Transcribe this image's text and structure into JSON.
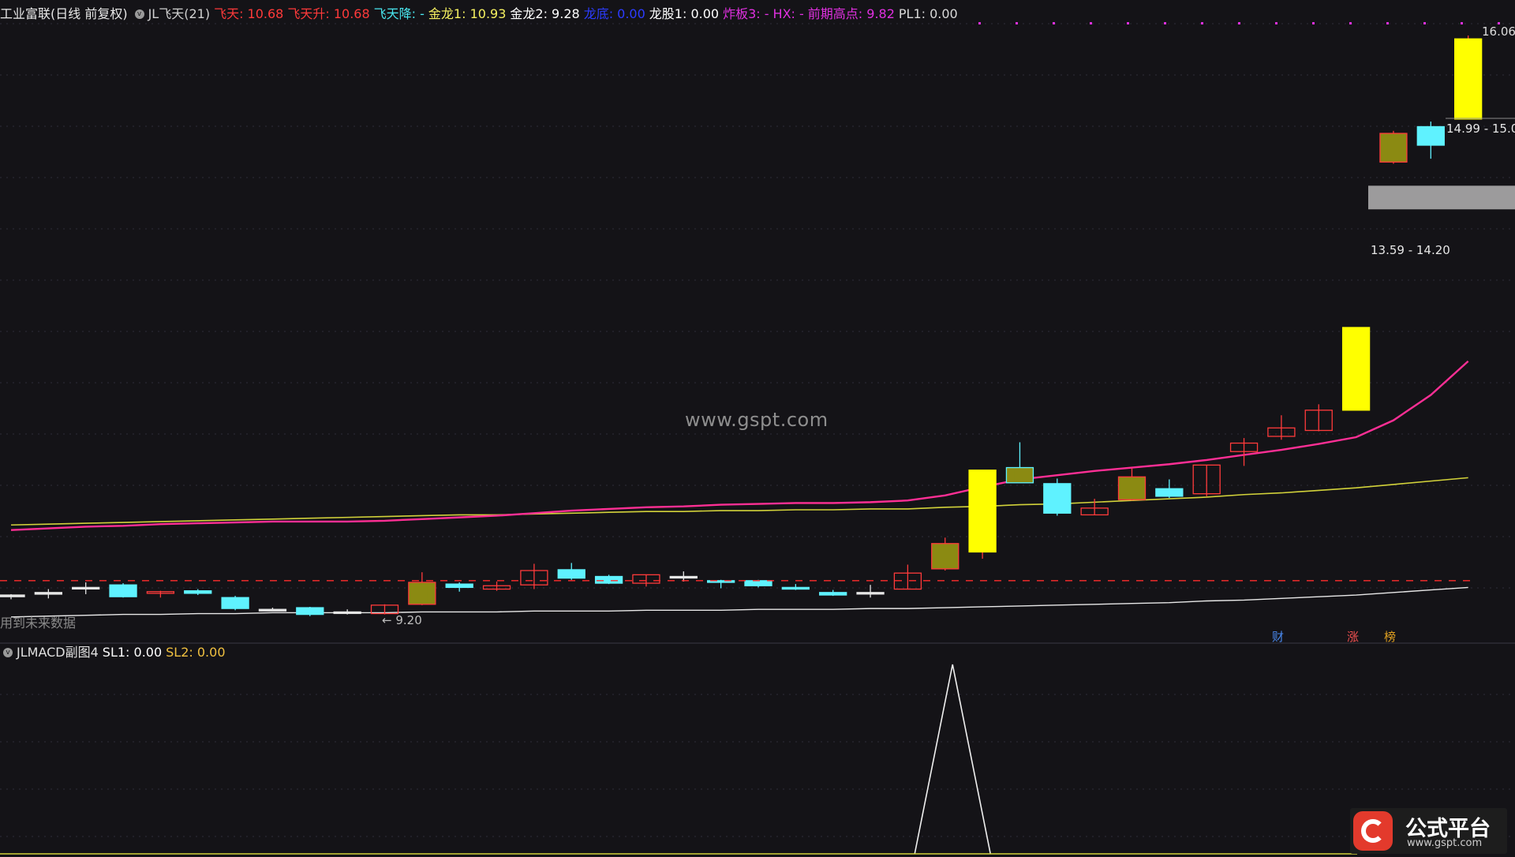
{
  "main_legend": {
    "stock_title": "工业富联(日线 前复权)",
    "indicator_name": "JL飞天(21)",
    "items": [
      {
        "text": "飞天: 10.68",
        "color": "#ff3a3a"
      },
      {
        "text": "飞天升: 10.68",
        "color": "#ff3a3a"
      },
      {
        "text": "飞天降: -",
        "color": "#49e6ef"
      },
      {
        "text": "金龙1: 10.93",
        "color": "#f5f060"
      },
      {
        "text": "金龙2: 9.28",
        "color": "#ffffff"
      },
      {
        "text": "龙底: 0.00",
        "color": "#2c3cff"
      },
      {
        "text": "龙股1: 0.00",
        "color": "#ffffff"
      },
      {
        "text": "炸板3: -",
        "color": "#e030e0"
      },
      {
        "text": "HX: -",
        "color": "#e030e0"
      },
      {
        "text": "前期高点: 9.82",
        "color": "#e030e0"
      },
      {
        "text": "PL1: 0.00",
        "color": "#d8d8d8"
      }
    ]
  },
  "sub_legend": {
    "indicator_name": "JLMACD副图4",
    "items": [
      {
        "text": "SL1: 0.00",
        "color": "#ffffff"
      },
      {
        "text": "SL2: 0.00",
        "color": "#f0c040"
      }
    ]
  },
  "price_labels": {
    "high": "16.06",
    "zone_upper": "14.99 - 15.0",
    "zone_lower": "13.59 - 14.20",
    "low_arrow": "← 9.20"
  },
  "future_data_note": "用到未来数据",
  "badges": [
    {
      "text": "财",
      "color": "#4a8af0"
    },
    {
      "text": "涨",
      "color": "#f05050"
    },
    {
      "text": "榜",
      "color": "#e0a020"
    }
  ],
  "watermark": "www.gspt.com",
  "logo": {
    "main": "公式平台",
    "url": "www.gspt.com"
  },
  "colors": {
    "up_candle": "#ff3b3b",
    "down_candle": "#5ff2ff",
    "limit_up": "#ffff00",
    "ma_pink": "#ff2f95",
    "ma_yellow": "#d2d23a",
    "ma_white": "#e8e8e8",
    "dashed_ref": "#ff2c2c",
    "zone_gray": "#b4b4b4"
  },
  "chart_data": {
    "type": "candlestick",
    "y_range": [
      9.0,
      16.2
    ],
    "candles": [
      {
        "o": 9.41,
        "c": 9.43,
        "h": 9.44,
        "l": 9.38,
        "t": "flat"
      },
      {
        "o": 9.46,
        "c": 9.44,
        "h": 9.5,
        "l": 9.39,
        "t": "flat"
      },
      {
        "o": 9.52,
        "c": 9.51,
        "h": 9.58,
        "l": 9.44,
        "t": "flat"
      },
      {
        "o": 9.55,
        "c": 9.41,
        "h": 9.57,
        "l": 9.4,
        "t": "down"
      },
      {
        "o": 9.45,
        "c": 9.47,
        "h": 9.48,
        "l": 9.4,
        "t": "up"
      },
      {
        "o": 9.48,
        "c": 9.45,
        "h": 9.5,
        "l": 9.43,
        "t": "down"
      },
      {
        "o": 9.4,
        "c": 9.27,
        "h": 9.42,
        "l": 9.25,
        "t": "down"
      },
      {
        "o": 9.26,
        "c": 9.25,
        "h": 9.28,
        "l": 9.24,
        "t": "flat"
      },
      {
        "o": 9.28,
        "c": 9.2,
        "h": 9.29,
        "l": 9.18,
        "t": "down"
      },
      {
        "o": 9.23,
        "c": 9.22,
        "h": 9.26,
        "l": 9.2,
        "t": "flat"
      },
      {
        "o": 9.21,
        "c": 9.31,
        "h": 9.32,
        "l": 9.2,
        "t": "up"
      },
      {
        "o": 9.32,
        "c": 9.58,
        "h": 9.7,
        "l": 9.31,
        "t": "up_fill"
      },
      {
        "o": 9.56,
        "c": 9.52,
        "h": 9.58,
        "l": 9.47,
        "t": "down"
      },
      {
        "o": 9.5,
        "c": 9.54,
        "h": 9.59,
        "l": 9.48,
        "t": "up"
      },
      {
        "o": 9.55,
        "c": 9.72,
        "h": 9.8,
        "l": 9.5,
        "t": "up"
      },
      {
        "o": 9.73,
        "c": 9.63,
        "h": 9.81,
        "l": 9.61,
        "t": "down"
      },
      {
        "o": 9.65,
        "c": 9.57,
        "h": 9.67,
        "l": 9.56,
        "t": "down"
      },
      {
        "o": 9.57,
        "c": 9.67,
        "h": 9.67,
        "l": 9.53,
        "t": "up"
      },
      {
        "o": 9.65,
        "c": 9.64,
        "h": 9.71,
        "l": 9.59,
        "t": "flat"
      },
      {
        "o": 9.6,
        "c": 9.58,
        "h": 9.61,
        "l": 9.51,
        "t": "down"
      },
      {
        "o": 9.6,
        "c": 9.54,
        "h": 9.61,
        "l": 9.52,
        "t": "down"
      },
      {
        "o": 9.52,
        "c": 9.5,
        "h": 9.56,
        "l": 9.49,
        "t": "down"
      },
      {
        "o": 9.46,
        "c": 9.43,
        "h": 9.49,
        "l": 9.42,
        "t": "down"
      },
      {
        "o": 9.45,
        "c": 9.46,
        "h": 9.55,
        "l": 9.4,
        "t": "flat"
      },
      {
        "o": 9.5,
        "c": 9.69,
        "h": 9.79,
        "l": 9.5,
        "t": "up"
      },
      {
        "o": 9.74,
        "c": 10.04,
        "h": 10.11,
        "l": 9.72,
        "t": "up_fill"
      },
      {
        "o": 9.94,
        "c": 10.91,
        "h": 10.91,
        "l": 9.86,
        "t": "limit"
      },
      {
        "o": 10.76,
        "c": 10.94,
        "h": 11.24,
        "l": 10.76,
        "t": "down_fill"
      },
      {
        "o": 10.75,
        "c": 10.4,
        "h": 10.81,
        "l": 10.37,
        "t": "down"
      },
      {
        "o": 10.38,
        "c": 10.46,
        "h": 10.57,
        "l": 10.38,
        "t": "up"
      },
      {
        "o": 10.56,
        "c": 10.83,
        "h": 10.93,
        "l": 10.55,
        "t": "up_fill"
      },
      {
        "o": 10.69,
        "c": 10.6,
        "h": 10.8,
        "l": 10.58,
        "t": "down"
      },
      {
        "o": 10.63,
        "c": 10.97,
        "h": 10.97,
        "l": 10.6,
        "t": "up"
      },
      {
        "o": 11.13,
        "c": 11.23,
        "h": 11.29,
        "l": 10.96,
        "t": "up"
      },
      {
        "o": 11.31,
        "c": 11.41,
        "h": 11.56,
        "l": 11.27,
        "t": "up"
      },
      {
        "o": 11.38,
        "c": 11.62,
        "h": 11.69,
        "l": 11.37,
        "t": "up"
      },
      {
        "o": 11.62,
        "c": 12.6,
        "h": 12.6,
        "l": 11.62,
        "t": "limit"
      },
      {
        "o": 14.56,
        "c": 14.9,
        "h": 14.93,
        "l": 14.54,
        "t": "up_fill"
      },
      {
        "o": 14.76,
        "c": 14.98,
        "h": 15.04,
        "l": 14.6,
        "t": "down"
      },
      {
        "o": 15.07,
        "c": 16.02,
        "h": 16.06,
        "l": 15.07,
        "t": "limit"
      }
    ],
    "ma_pink": [
      10.2,
      10.22,
      10.24,
      10.25,
      10.27,
      10.28,
      10.29,
      10.3,
      10.3,
      10.3,
      10.31,
      10.33,
      10.35,
      10.37,
      10.4,
      10.43,
      10.45,
      10.47,
      10.48,
      10.5,
      10.51,
      10.52,
      10.52,
      10.53,
      10.55,
      10.61,
      10.71,
      10.8,
      10.85,
      10.9,
      10.94,
      10.98,
      11.03,
      11.09,
      11.15,
      11.22,
      11.3,
      11.5,
      11.8,
      12.2
    ],
    "ma_yellow": [
      10.26,
      10.27,
      10.28,
      10.29,
      10.3,
      10.31,
      10.32,
      10.33,
      10.34,
      10.35,
      10.36,
      10.37,
      10.38,
      10.38,
      10.39,
      10.4,
      10.41,
      10.42,
      10.42,
      10.43,
      10.43,
      10.44,
      10.44,
      10.45,
      10.45,
      10.47,
      10.48,
      10.5,
      10.51,
      10.53,
      10.55,
      10.57,
      10.59,
      10.62,
      10.64,
      10.67,
      10.7,
      10.74,
      10.78,
      10.82
    ],
    "ma_white": [
      9.17,
      9.18,
      9.19,
      9.2,
      9.2,
      9.21,
      9.21,
      9.22,
      9.22,
      9.22,
      9.22,
      9.23,
      9.23,
      9.23,
      9.24,
      9.24,
      9.24,
      9.25,
      9.25,
      9.25,
      9.26,
      9.26,
      9.26,
      9.27,
      9.27,
      9.28,
      9.29,
      9.3,
      9.31,
      9.32,
      9.33,
      9.34,
      9.36,
      9.37,
      9.39,
      9.41,
      9.43,
      9.46,
      9.49,
      9.52
    ],
    "resistance_line": 9.6,
    "zone": [
      14.0,
      14.28
    ],
    "sub_peak_index": 25.2
  }
}
